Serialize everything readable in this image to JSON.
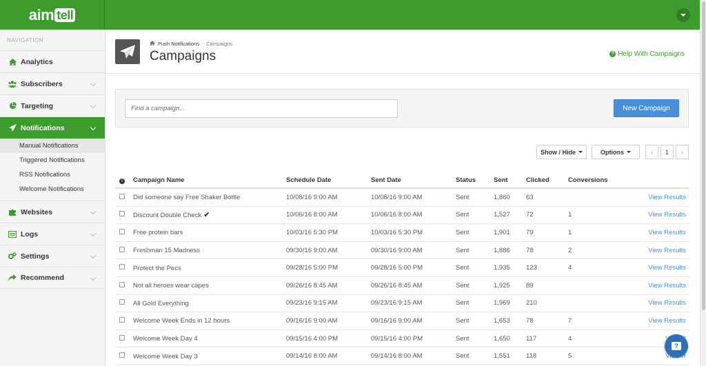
{
  "brand": {
    "logo_main": "aim",
    "logo_bubble": "tell"
  },
  "sidebar": {
    "heading": "NAVIGATION",
    "items": [
      {
        "label": "Analytics",
        "icon": "home-icon"
      },
      {
        "label": "Subscribers",
        "icon": "users-icon"
      },
      {
        "label": "Targeting",
        "icon": "pie-chart-icon"
      },
      {
        "label": "Notifications",
        "icon": "paper-plane-icon"
      },
      {
        "label": "Websites",
        "icon": "puzzle-icon"
      },
      {
        "label": "Logs",
        "icon": "list-icon"
      },
      {
        "label": "Settings",
        "icon": "cogs-icon"
      },
      {
        "label": "Recommend",
        "icon": "share-icon"
      }
    ],
    "sub_items": [
      "Manual Notifications",
      "Triggered Notifications",
      "RSS Notifications",
      "Welcome Notifications"
    ]
  },
  "header": {
    "breadcrumb_parent": "Push Notifications",
    "breadcrumb_sep": "/",
    "breadcrumb_current": "Campaigns",
    "title": "Campaigns",
    "help": "Help With Campaigns"
  },
  "search": {
    "placeholder": "Find a campaign...",
    "new_label": "New Campaign"
  },
  "toolbar": {
    "show_hide": "Show / Hide",
    "options": "Options",
    "page": "1",
    "prev": "‹",
    "next": "›"
  },
  "table": {
    "headers": {
      "name": "Campaign Name",
      "schedule": "Schedule Date",
      "sent_date": "Sent Date",
      "status": "Status",
      "sent": "Sent",
      "clicked": "Clicked",
      "conversions": "Conversions"
    },
    "rows": [
      {
        "name": "Did someone say Free Shaker Bottle",
        "schedule": "10/08/16 9:00 AM",
        "sent_date": "10/08/16 9:00 AM",
        "status": "Sent",
        "sent": "1,860",
        "clicked": "63",
        "conversions": "",
        "view": "View Results",
        "check": ""
      },
      {
        "name": "Discount Double Check",
        "schedule": "10/06/16 8:00 AM",
        "sent_date": "10/06/16 8:00 AM",
        "status": "Sent",
        "sent": "1,527",
        "clicked": "72",
        "conversions": "1",
        "view": "View Results",
        "check": "✔"
      },
      {
        "name": "Free protein bars",
        "schedule": "10/03/16 5:30 PM",
        "sent_date": "10/03/16 5:30 PM",
        "status": "Sent",
        "sent": "1,901",
        "clicked": "79",
        "conversions": "1",
        "view": "View Results",
        "check": ""
      },
      {
        "name": "Freshman 15 Madness",
        "schedule": "09/30/16 9:00 AM",
        "sent_date": "09/30/16 9:00 AM",
        "status": "Sent",
        "sent": "1,886",
        "clicked": "78",
        "conversions": "2",
        "view": "View Results",
        "check": ""
      },
      {
        "name": "Protect the Pecs",
        "schedule": "09/28/16 5:00 PM",
        "sent_date": "09/28/16 5:00 PM",
        "status": "Sent",
        "sent": "1,935",
        "clicked": "123",
        "conversions": "4",
        "view": "View Results",
        "check": ""
      },
      {
        "name": "Not all heroes wear capes",
        "schedule": "09/26/16 8:45 AM",
        "sent_date": "09/26/16 8:45 AM",
        "status": "Sent",
        "sent": "1,925",
        "clicked": "89",
        "conversions": "",
        "view": "View Results",
        "check": ""
      },
      {
        "name": "All Gold Everything",
        "schedule": "09/23/16 9:15 AM",
        "sent_date": "09/23/16 9:15 AM",
        "status": "Sent",
        "sent": "1,969",
        "clicked": "210",
        "conversions": "",
        "view": "View Results",
        "check": ""
      },
      {
        "name": "Welcome Week Ends in 12 hours",
        "schedule": "09/16/16 9:00 AM",
        "sent_date": "09/16/16 9:00 AM",
        "status": "Sent",
        "sent": "1,653",
        "clicked": "78",
        "conversions": "7",
        "view": "View Results",
        "check": ""
      },
      {
        "name": "Welcome Week Day 4",
        "schedule": "09/15/16 4:00 PM",
        "sent_date": "09/15/16 4:00 PM",
        "status": "Sent",
        "sent": "1,650",
        "clicked": "117",
        "conversions": "4",
        "view": "View R",
        "check": ""
      },
      {
        "name": "Welcome Week Day 3",
        "schedule": "09/14/16 8:00 AM",
        "sent_date": "09/14/16 8:00 AM",
        "status": "Sent",
        "sent": "1,551",
        "clicked": "118",
        "conversions": "5",
        "view": "View R",
        "check": ""
      }
    ]
  },
  "colors": {
    "brand_green": "#3e9b2e",
    "link_blue": "#4a90d9"
  }
}
